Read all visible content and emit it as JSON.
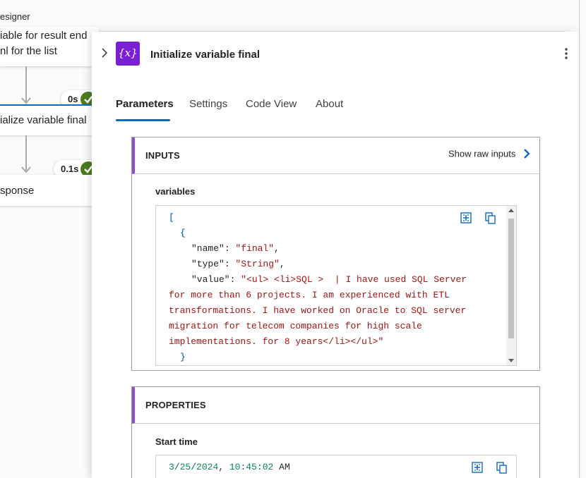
{
  "designer": {
    "title": "esigner",
    "steps": [
      {
        "line1": "iable for result end",
        "line2": "nl for the list"
      },
      {
        "line1": "ialize variable final"
      },
      {
        "line1": "sponse"
      }
    ],
    "badges": [
      {
        "duration": "0s"
      },
      {
        "duration": "0.1s"
      }
    ]
  },
  "panel": {
    "action_icon_text": "{x}",
    "title": "Initialize variable final",
    "tabs": [
      {
        "label": "Parameters",
        "active": true
      },
      {
        "label": "Settings",
        "active": false
      },
      {
        "label": "Code View",
        "active": false
      },
      {
        "label": "About",
        "active": false
      }
    ],
    "inputs": {
      "section_title": "INPUTS",
      "raw_link": "Show raw inputs",
      "field_label": "variables",
      "code": {
        "open_bracket": "[",
        "open_brace": "{",
        "name_key": "\"name\"",
        "name_value": "\"final\"",
        "type_key": "\"type\"",
        "type_value": "\"String\"",
        "value_key": "\"value\"",
        "value_line1": "\"<ul> <li>SQL >  | I have used SQL Server",
        "value_line2": "for more than 6 projects. I am experienced with ETL",
        "value_line3": "transformations. I have worked on Oracle to SQL server",
        "value_line4": "migration for telecom companies for high scale",
        "value_line5": "implementations. for 8 years</li></ul>\"",
        "close_brace": "}"
      }
    },
    "properties": {
      "section_title": "PROPERTIES",
      "field_label": "Start time",
      "start_time": {
        "month": "3",
        "day": "25",
        "year": "2024",
        "hour": "10",
        "minute": "45",
        "second": "02",
        "ampm": "AM"
      }
    }
  },
  "colors": {
    "accent_blue": "#0f6cbd",
    "action_purple": "#7b1fd4",
    "section_accent": "#8a4fd4",
    "success_green": "#4a7c1f",
    "json_string": "#a31515",
    "json_punct": "#0451a5",
    "json_number": "#098658"
  },
  "icons": {
    "collapse": "chevron-right-icon",
    "more": "more-vertical-icon",
    "raw_inputs": "chevron-right-icon",
    "expand": "expand-icon",
    "copy": "copy-icon",
    "status": "checkmark-icon"
  }
}
